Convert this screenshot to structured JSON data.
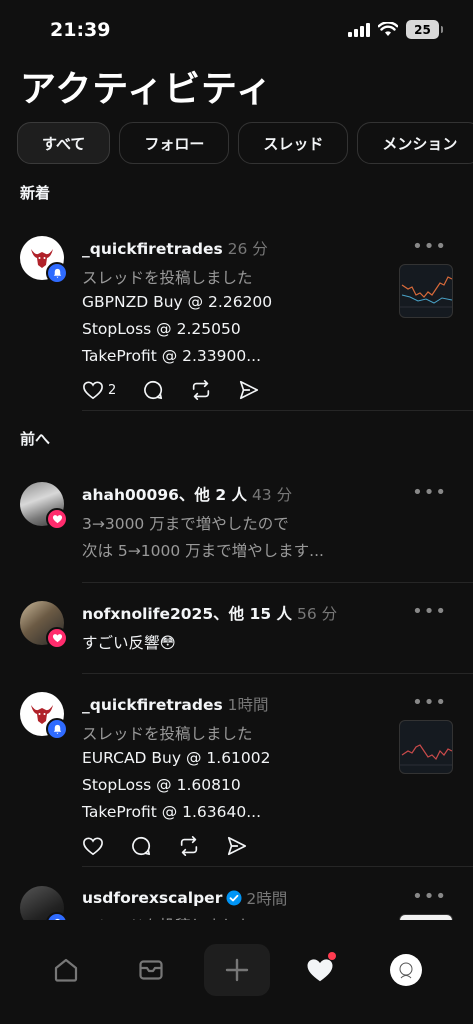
{
  "status": {
    "time": "21:39",
    "battery": "25"
  },
  "header": {
    "title": "アクティビティ"
  },
  "filters": [
    {
      "label": "すべて"
    },
    {
      "label": "フォロー"
    },
    {
      "label": "スレッド"
    },
    {
      "label": "メンション"
    }
  ],
  "sections": {
    "new": "新着",
    "earlier": "前へ"
  },
  "items": [
    {
      "username": "_quickfiretrades",
      "time": "26 分",
      "subtext": "スレッドを投稿しました",
      "lines": [
        "GBPNZD Buy @ 2.26200",
        "StopLoss @ 2.25050",
        "TakeProfit @ 2.33900..."
      ],
      "likes": "2",
      "badge": "bell"
    },
    {
      "username": "ahah00096",
      "others": "、他 2 人",
      "time": "43 分",
      "lines": [
        "3→3000 万まで増やしたので",
        "次は 5→1000 万まで増やします..."
      ],
      "badge": "heart"
    },
    {
      "username": "nofxnolife2025",
      "others": "、他 15 人",
      "time": "56 分",
      "lines": [
        "すごい反響😳"
      ],
      "badge": "heart"
    },
    {
      "username": "_quickfiretrades",
      "time": "1時間",
      "subtext": "スレッドを投稿しました",
      "lines": [
        "EURCAD Buy @ 1.61002",
        "StopLoss @ 1.60810",
        "TakeProfit @ 1.63640..."
      ],
      "badge": "bell"
    },
    {
      "username": "usdforexscalper",
      "time": "2時間",
      "subtext": "スレッドを投稿しました",
      "verified": true,
      "badge": "bell"
    }
  ],
  "more_label": "•••",
  "colors": {
    "background": "#101010",
    "notify_blue": "#2f6bff",
    "like_pink": "#ff2c6d",
    "unread_dot": "#ff3b50"
  },
  "tabbar": [
    "home-icon",
    "inbox-icon",
    "plus-icon",
    "heart-icon",
    "profile-avatar"
  ]
}
